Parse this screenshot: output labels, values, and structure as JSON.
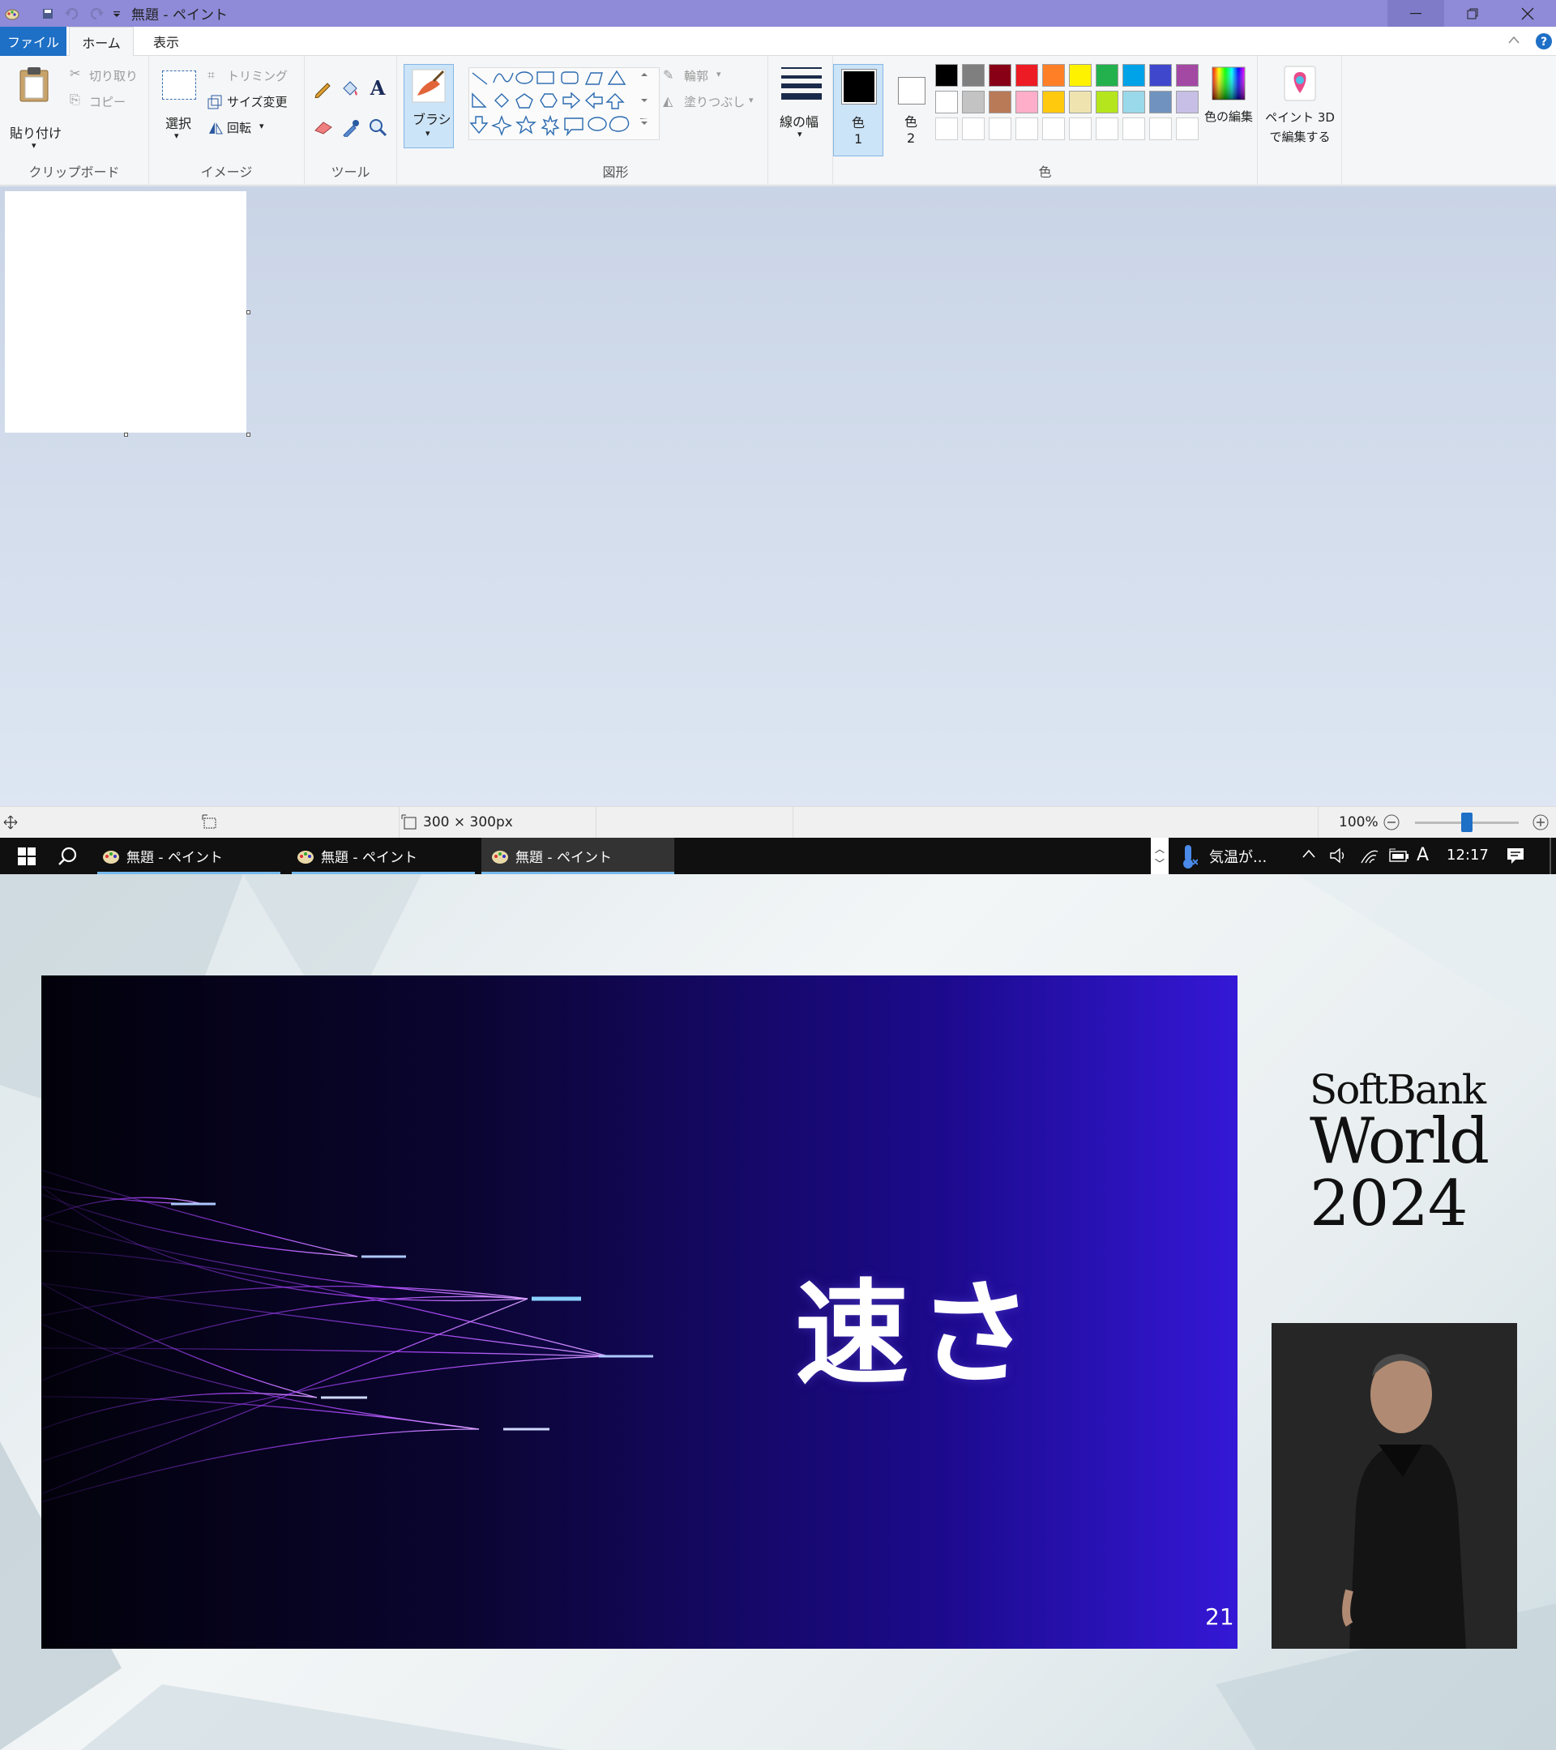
{
  "titlebar": {
    "title": "無題 - ペイント",
    "color": "#8f8bd8",
    "icons": [
      "paint-app-icon",
      "save-icon",
      "undo-icon",
      "redo-icon",
      "customize-dropdown-icon"
    ],
    "window_controls": [
      "minimize-icon",
      "restore-icon",
      "close-icon"
    ]
  },
  "tabs": {
    "file": "ファイル",
    "home": "ホーム",
    "view": "表示"
  },
  "ribbon": {
    "clipboard": {
      "paste": "貼り付け",
      "cut": "切り取り",
      "copy": "コピー",
      "label": "クリップボード"
    },
    "image": {
      "select": "選択",
      "crop": "トリミング",
      "resize": "サイズ変更",
      "rotate": "回転",
      "label": "イメージ"
    },
    "tools": {
      "label": "ツール",
      "icons": [
        "pencil-icon",
        "fill-icon",
        "text-icon",
        "eraser-icon",
        "color-picker-icon",
        "magnifier-icon"
      ]
    },
    "brushes": {
      "label": "ブラシ"
    },
    "shapes": {
      "label": "図形",
      "outline": "輪郭",
      "fill": "塗りつぶし"
    },
    "size": {
      "label": "線の幅"
    },
    "colors": {
      "color1": "色",
      "color1_num": "1",
      "color2": "色",
      "color2_num": "2",
      "edit": "色の編集",
      "label": "色",
      "paint3d": "ペイント 3D で編集する",
      "palette_row1": [
        "#000000",
        "#7f7f7f",
        "#880015",
        "#ed1c24",
        "#ff7f27",
        "#fff200",
        "#22b14c",
        "#00a2e8",
        "#3f48cc",
        "#a349a4"
      ],
      "palette_row2": [
        "#ffffff",
        "#c3c3c3",
        "#b97a57",
        "#ffaec9",
        "#ffc90e",
        "#efe4b0",
        "#b5e61d",
        "#99d9ea",
        "#7092be",
        "#c8bfe7"
      ]
    }
  },
  "statusbar": {
    "canvas_size": "300 × 300px",
    "zoom": "100%",
    "zoom_level": 0.5
  },
  "taskbar": {
    "apps": [
      {
        "label": "無題 - ペイント"
      },
      {
        "label": "無題 - ペイント"
      },
      {
        "label": "無題 - ペイント"
      }
    ],
    "weather": "気温が...",
    "ime": "A",
    "clock": "12:17"
  },
  "video": {
    "slide_text": "速さ",
    "slide_number": "21",
    "logo_line1": "SoftBank",
    "logo_line2": "World",
    "logo_line3": "2024"
  }
}
